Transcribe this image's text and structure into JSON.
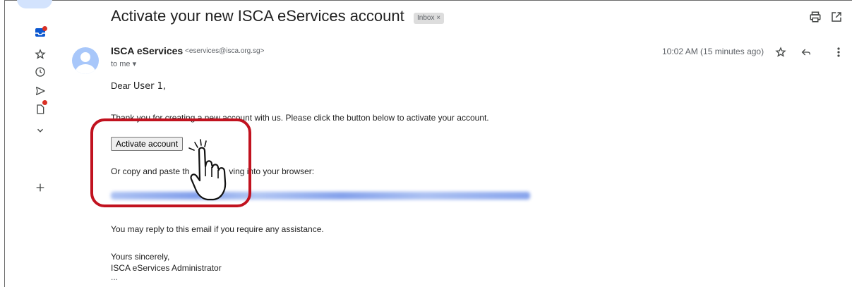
{
  "email": {
    "subject": "Activate your new ISCA eServices account",
    "label_chip": "Inbox ×",
    "sender_name": "ISCA eServices",
    "sender_email": "<eservices@isca.org.sg>",
    "recipient": "to me ▾",
    "timestamp": "10:02 AM (15 minutes ago)",
    "greeting_prefix": "Dear",
    "greeting_name": "User 1,",
    "line_thanks": "Thank you for creating a new account with us. Please click the button below to activate your account.",
    "activate_label": "Activate account",
    "copy_paste_before": "Or copy and paste th",
    "copy_paste_after": "ving into your browser:",
    "reply_note": "You may reply to this email if you require any assistance.",
    "signoff": "Yours sincerely,",
    "signature": "ISCA eServices Administrator",
    "trimmed": "..."
  },
  "icons": {
    "header": [
      "print-icon",
      "open-in-new-window-icon"
    ],
    "sender_actions": [
      "star-icon",
      "reply-icon",
      "more-vert-icon"
    ],
    "rail": [
      "inbox-icon",
      "star-icon",
      "clock-icon",
      "send-icon",
      "draft-icon",
      "chevron-down-icon",
      "plus-icon"
    ]
  },
  "colors": {
    "highlight": "#c1121f",
    "unread_dot": "#d93025",
    "avatar": "#a8c7fa",
    "rail_active": "#d3e3fd"
  }
}
